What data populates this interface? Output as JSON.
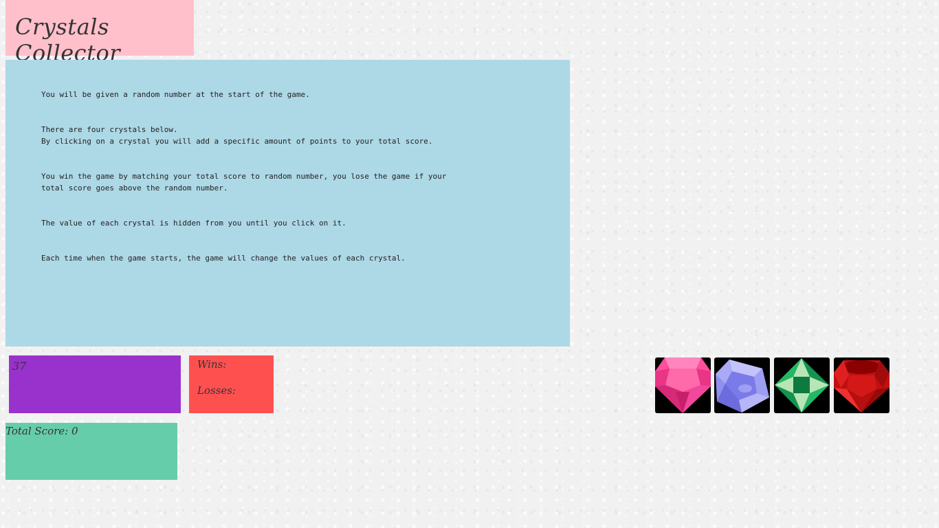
{
  "game": {
    "title": "Crystals Collector"
  },
  "rules": {
    "text": "You will be given a random number at the start of the game.\n\n\nThere are four crystals below.\nBy clicking on a crystal you will add a specific amount of points to your total score.\n\n\nYou win the game by matching your total score to random number, you lose the game if your\ntotal score goes above the random number.\n\n\nThe value of each crystal is hidden from you until you click on it.\n\n\nEach time when the game starts, the game will change the values of each crystal."
  },
  "target": {
    "number": "37"
  },
  "record": {
    "wins_label": "Wins:",
    "losses_label": "Losses:"
  },
  "score": {
    "label": "Total Score: 0"
  },
  "crystals": [
    {
      "name": "pink-crystal",
      "icon": "pink-gem-icon",
      "color": "#ff4f9a"
    },
    {
      "name": "blue-crystal",
      "icon": "blue-gem-icon",
      "color": "#8f8ff0"
    },
    {
      "name": "green-crystal",
      "icon": "green-gem-icon",
      "color": "#1fa760"
    },
    {
      "name": "red-crystal",
      "icon": "red-gem-icon",
      "color": "#cc1111"
    }
  ]
}
